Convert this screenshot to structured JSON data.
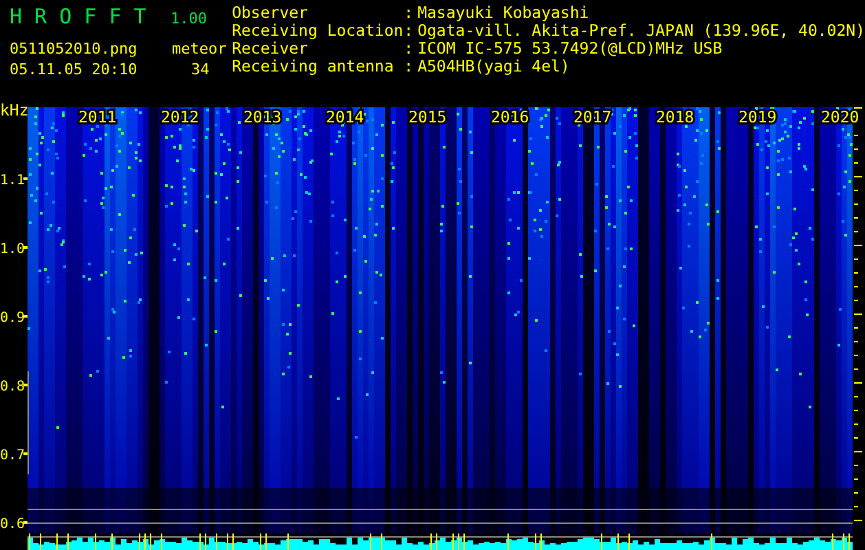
{
  "header": {
    "app_name": "H R O F F T",
    "version": "1.00",
    "filename": "0511052010.png",
    "datetime": "05.11.05 20:10",
    "meteor_label": "meteor",
    "meteor_count": "34"
  },
  "station_info": [
    {
      "label": "Observer",
      "separator": ":",
      "value": "Masayuki Kobayashi"
    },
    {
      "label": "Receiving Location",
      "separator": ":",
      "value": "Ogata-vill. Akita-Pref. JAPAN (139.96E, 40.02N)"
    },
    {
      "label": "Receiver",
      "separator": ":",
      "value": "ICOM IC-575 53.7492(@LCD)MHz USB"
    },
    {
      "label": "Receiving antenna",
      "separator": ":",
      "value": "A504HB(yagi 4el)"
    }
  ],
  "plot": {
    "unit": "kHz",
    "y_labels": [
      "1.1",
      "1.0",
      "0.9",
      "0.8",
      "0.7",
      "0.6"
    ],
    "year_labels": [
      "2011",
      "2012",
      "2013",
      "2014",
      "2015",
      "2016",
      "2017",
      "2018",
      "2019",
      "2020"
    ]
  }
}
